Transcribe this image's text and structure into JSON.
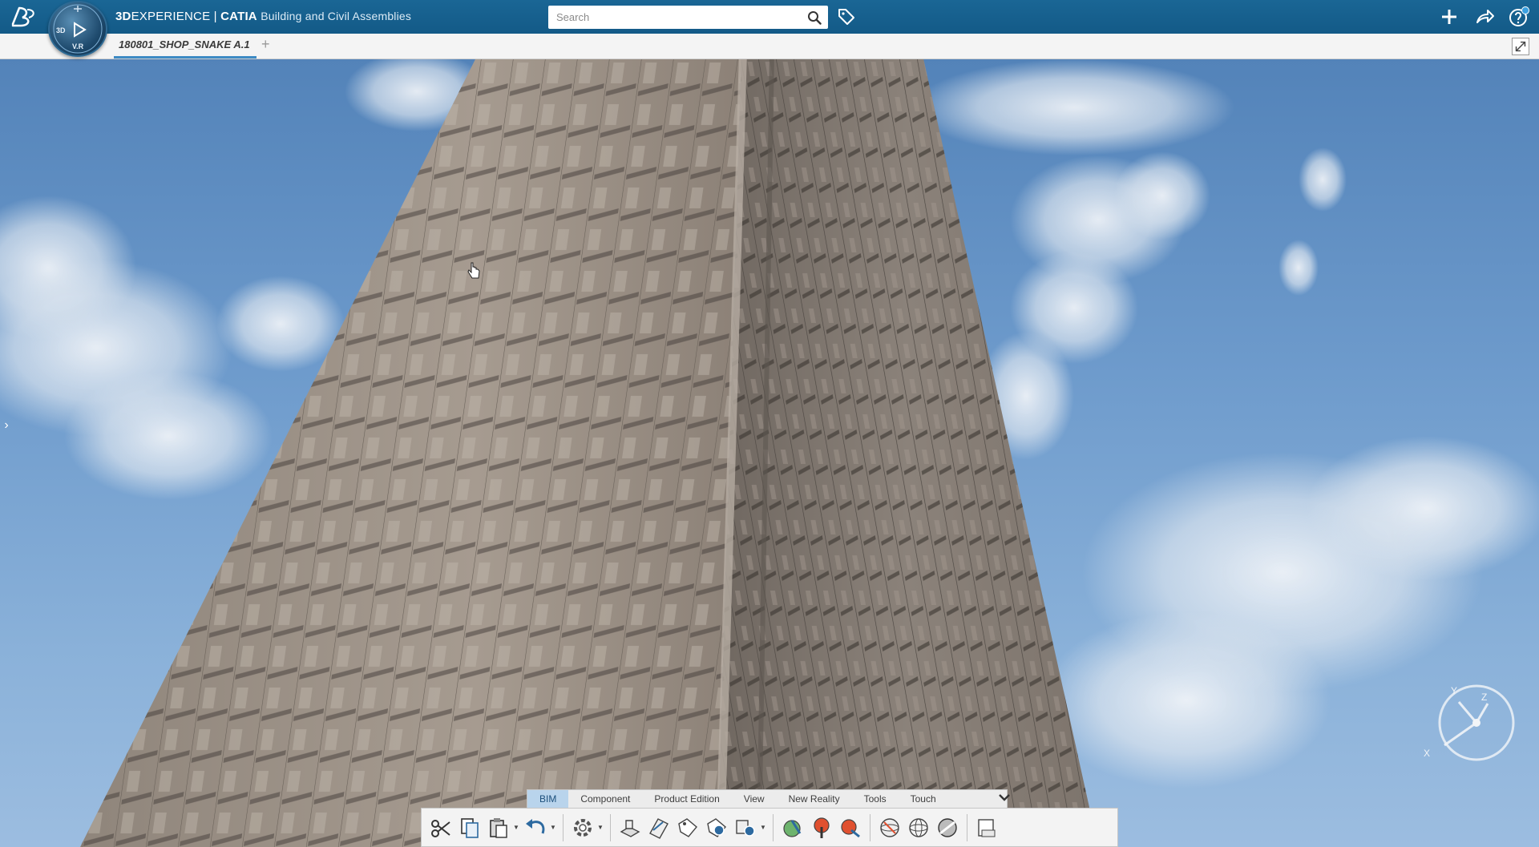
{
  "topbar": {
    "brand_3d": "3D",
    "brand_experience": "EXPERIENCE",
    "brand_sep": " | ",
    "brand_catia": "CATIA",
    "app_name": "Building and Civil Assemblies",
    "compass_labels": [
      "3D",
      "V.R"
    ],
    "search_placeholder": "Search"
  },
  "tabs": {
    "document": "180801_SHOP_SNAKE A.1",
    "add": "+"
  },
  "action_bar": {
    "sections": [
      "BIM",
      "Component",
      "Product Edition",
      "View",
      "New Reality",
      "Tools",
      "Touch"
    ],
    "active_section": "BIM"
  },
  "compass3d": {
    "axes": [
      "Y",
      "Z",
      "X"
    ]
  },
  "colors": {
    "topbar": "#135a87",
    "accent": "#3d8ac4",
    "sky": "#6e9bcc",
    "facade": "#9c9186"
  }
}
